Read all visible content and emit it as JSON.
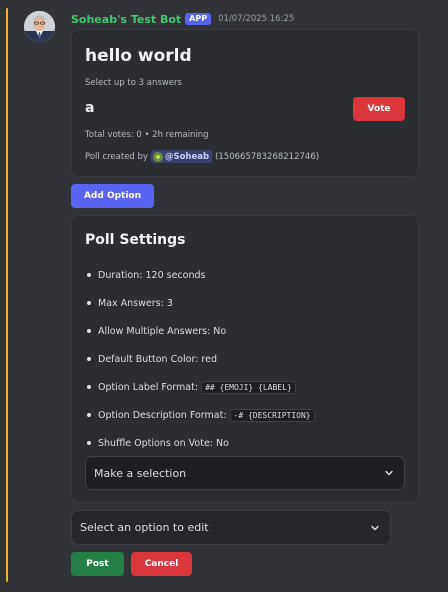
{
  "message": {
    "author": "Soheab's Test Bot",
    "badge": "APP",
    "timestamp": "01/07/2025 16:25",
    "avatar_icon": "user-avatar-photo"
  },
  "poll": {
    "title": "hello world",
    "subtitle": "Select up to 3 answers",
    "answer": "a",
    "vote_label": "Vote",
    "total": "Total votes: 0 • 2h remaining",
    "created_by_prefix": "Poll created by",
    "creator_mention": "@Soheab",
    "creator_id": "(150665783268212746)"
  },
  "add_option_label": "Add Option",
  "settings": {
    "title": "Poll Settings",
    "duration": "Duration: 120 seconds",
    "max_answers": "Max Answers: 3",
    "allow_multiple": "Allow Multiple Answers: No",
    "default_color": "Default Button Color: red",
    "label_format_prefix": "Option Label Format:",
    "label_format_code": "## {EMOJI} {LABEL}",
    "desc_format_prefix": "Option Description Format:",
    "desc_format_code": "-# {DESCRIPTION}",
    "shuffle": "Shuffle Options on Vote: No",
    "select_placeholder": "Make a selection"
  },
  "edit_select_placeholder": "Select an option to edit",
  "actions": {
    "post_label": "Post",
    "cancel_label": "Cancel"
  },
  "colors": {
    "background": "#323339",
    "accent": "#5865f2",
    "danger": "#da373c",
    "success": "#248046",
    "username": "#3fc96d",
    "highlight_bar": "#f0b232"
  }
}
